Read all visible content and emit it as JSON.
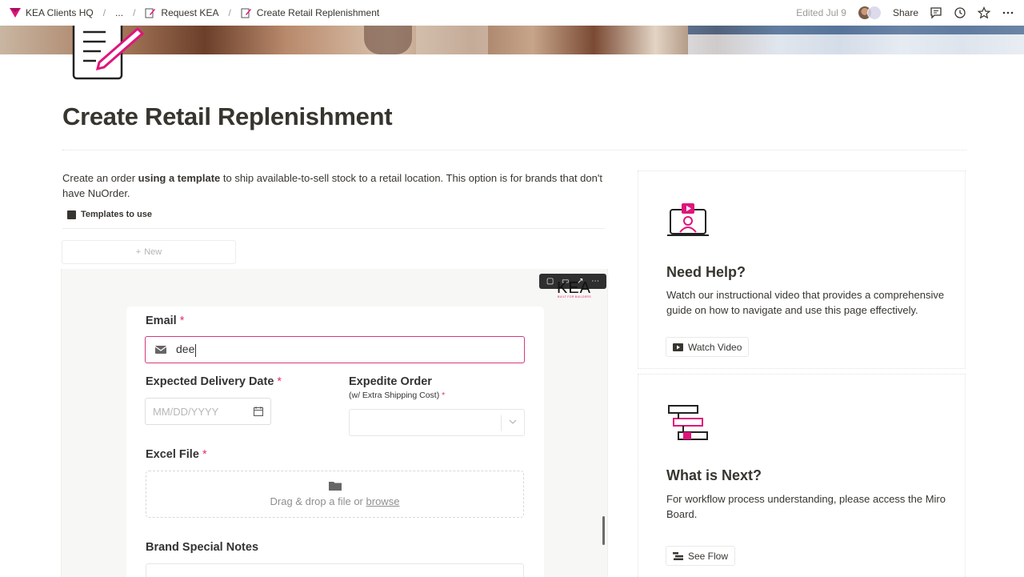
{
  "breadcrumb": {
    "workspace": "KEA Clients HQ",
    "ellipsis": "...",
    "parent": "Request KEA",
    "current": "Create Retail Replenishment"
  },
  "topbar": {
    "edited": "Edited Jul 9",
    "share": "Share"
  },
  "page": {
    "title": "Create Retail Replenishment",
    "intro_prefix": "Create an order ",
    "intro_bold": "using a template",
    "intro_suffix": " to ship available-to-sell stock to a retail location. This option is for brands that don't have NuOrder.",
    "templates_label": "Templates to use",
    "new_label": "New"
  },
  "embed": {
    "logo": "KEA",
    "logo_sub": "BUILT FOR BUILDERS"
  },
  "form": {
    "email_label": "Email",
    "email_value": "dee",
    "delivery_label": "Expected Delivery Date",
    "delivery_placeholder": "MM/DD/YYYY",
    "expedite_label": "Expedite Order",
    "expedite_sub": "(w/ Extra Shipping Cost)",
    "excel_label": "Excel File",
    "drop_text": "Drag & drop a file or",
    "drop_link": "browse",
    "notes_label": "Brand Special Notes",
    "required_mark": "*"
  },
  "help_card": {
    "title": "Need Help?",
    "desc": "Watch our instructional video that provides a comprehensive guide on how to navigate and use this page effectively.",
    "button": "Watch Video"
  },
  "next_card": {
    "title": "What is Next?",
    "desc": "For workflow process understanding, please access the Miro Board.",
    "button": "See Flow"
  },
  "colors": {
    "accent": "#e0147c",
    "focus_border": "#d8377c"
  }
}
